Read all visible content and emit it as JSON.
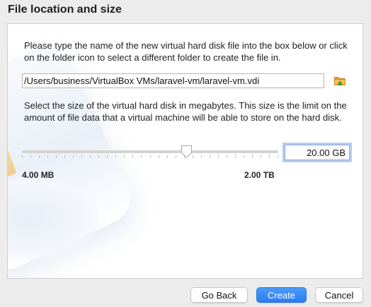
{
  "header": {
    "title": "File location and size"
  },
  "location": {
    "description": "Please type the name of the new virtual hard disk file into the box below or click on the folder icon to select a different folder to create the file in.",
    "path_value": "/Users/business/VirtualBox VMs/laravel-vm/laravel-vm.vdi",
    "folder_icon": "folder-icon"
  },
  "size": {
    "description": "Select the size of the virtual hard disk in megabytes. This size is the limit on the amount of file data that a virtual machine will be able to store on the hard disk.",
    "slider_fraction": 0.64,
    "min_label": "4.00 MB",
    "max_label": "2.00 TB",
    "value": "20.00 GB"
  },
  "buttons": {
    "back": "Go Back",
    "create": "Create",
    "cancel": "Cancel"
  },
  "colors": {
    "primary": "#2b7cf3",
    "focus_ring": "#b6cdf2"
  }
}
